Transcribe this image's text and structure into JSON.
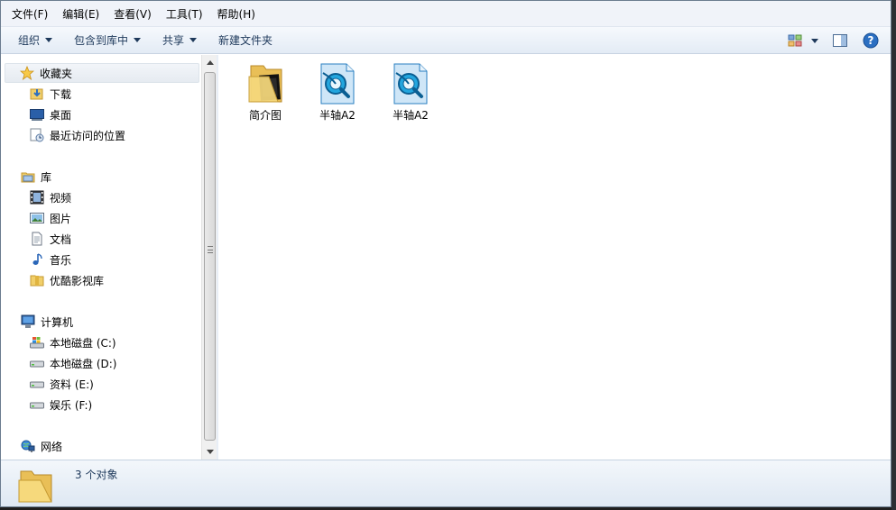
{
  "menubar": {
    "items": [
      "文件(F)",
      "编辑(E)",
      "查看(V)",
      "工具(T)",
      "帮助(H)"
    ]
  },
  "toolbar": {
    "organize": "组织",
    "include_in_library": "包含到库中",
    "share": "共享",
    "new_folder": "新建文件夹"
  },
  "nav": {
    "favorites": "收藏夹",
    "downloads": "下载",
    "desktop": "桌面",
    "recent": "最近访问的位置",
    "libraries": "库",
    "videos": "视频",
    "pictures": "图片",
    "documents": "文档",
    "music": "音乐",
    "youku": "优酷影视库",
    "computer": "计算机",
    "drive_c": "本地磁盘 (C:)",
    "drive_d": "本地磁盘 (D:)",
    "drive_e": "资料 (E:)",
    "drive_f": "娱乐 (F:)",
    "network": "网络"
  },
  "files": [
    {
      "name": "简介图",
      "icon": "folder-icon"
    },
    {
      "name": "半轴A2",
      "icon": "cad-file-icon"
    },
    {
      "name": "半轴A2",
      "icon": "cad-file-icon"
    }
  ],
  "status": {
    "count": "3 个对象"
  },
  "colors": {
    "accent": "#1e395b",
    "folder": "#f1cf6a",
    "help": "#2b6fc2"
  }
}
